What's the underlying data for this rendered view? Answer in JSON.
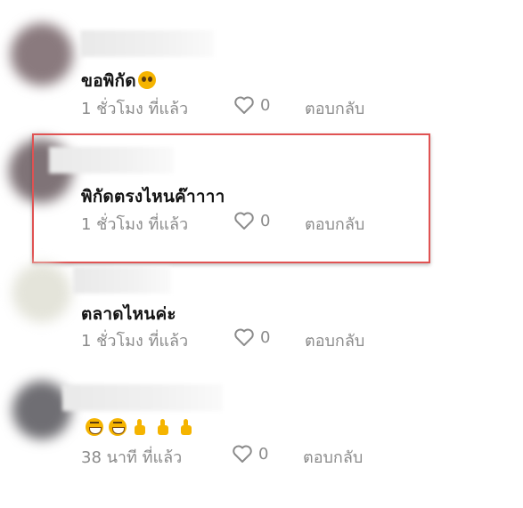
{
  "comments": [
    {
      "text": "ขอพิกัด",
      "emoji_icon": "pleading-face-icon",
      "time": "1 ชั่วโมง ที่แล้ว",
      "likes": "0",
      "reply": "ตอบกลับ"
    },
    {
      "text": "พิกัดตรงไหนค๊าาาา",
      "time": "1 ชั่วโมง ที่แล้ว",
      "likes": "0",
      "reply": "ตอบกลับ",
      "highlighted": true
    },
    {
      "text": "ตลาดไหนค่ะ",
      "time": "1 ชั่วโมง ที่แล้ว",
      "likes": "0",
      "reply": "ตอบกลับ"
    },
    {
      "emojis": [
        "grinning-face-icon",
        "grinning-face-icon",
        "thumbs-up-icon",
        "thumbs-up-icon",
        "thumbs-up-icon"
      ],
      "time": "38 นาที ที่แล้ว",
      "likes": "0",
      "reply": "ตอบกลับ"
    }
  ],
  "colors": {
    "highlight_border": "#e05252",
    "meta_text": "#8b8b8b",
    "emoji": "#f5b400"
  }
}
